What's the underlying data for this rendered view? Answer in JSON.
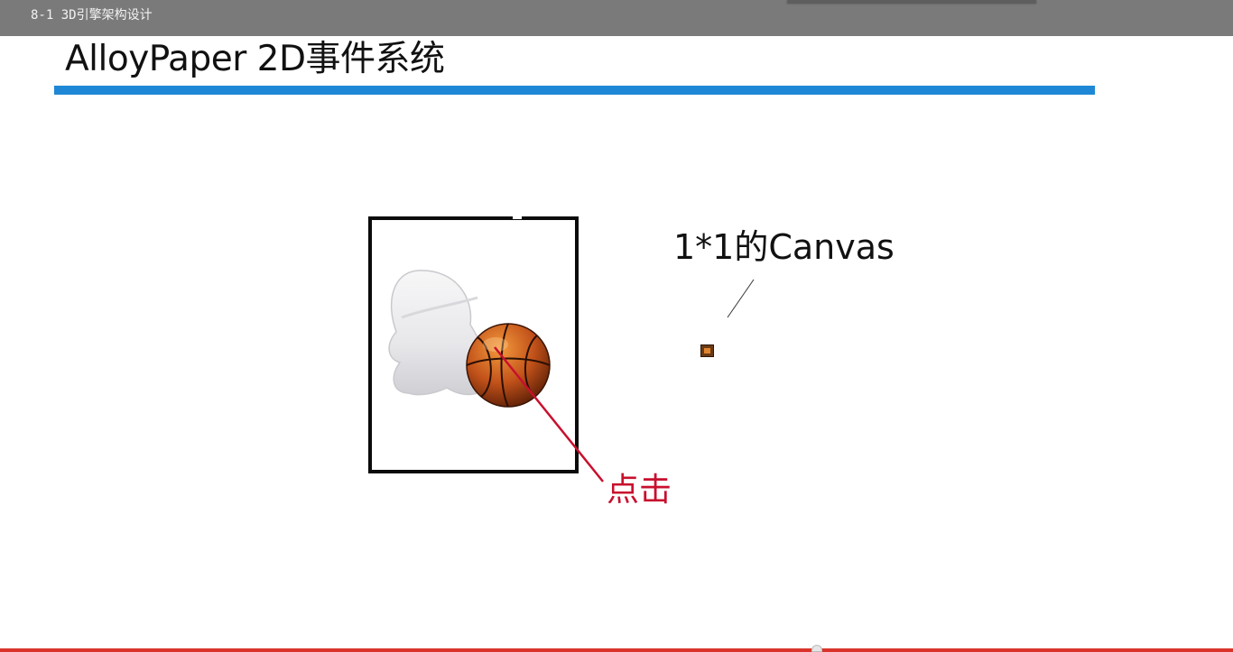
{
  "window": {
    "title": "8-1 3D引擎架构设计"
  },
  "slide": {
    "title": "AlloyPaper 2D事件系统",
    "canvas_label": "1*1的Canvas",
    "click_label": "点击"
  },
  "colors": {
    "accent_rule": "#1e88d6",
    "click_text": "#c8102e",
    "titlebar": "#7a7a7a"
  },
  "icons": {
    "artwork": "qq-penguin-with-basketball-icon",
    "tiny_canvas": "tiny-canvas-swatch-icon"
  }
}
